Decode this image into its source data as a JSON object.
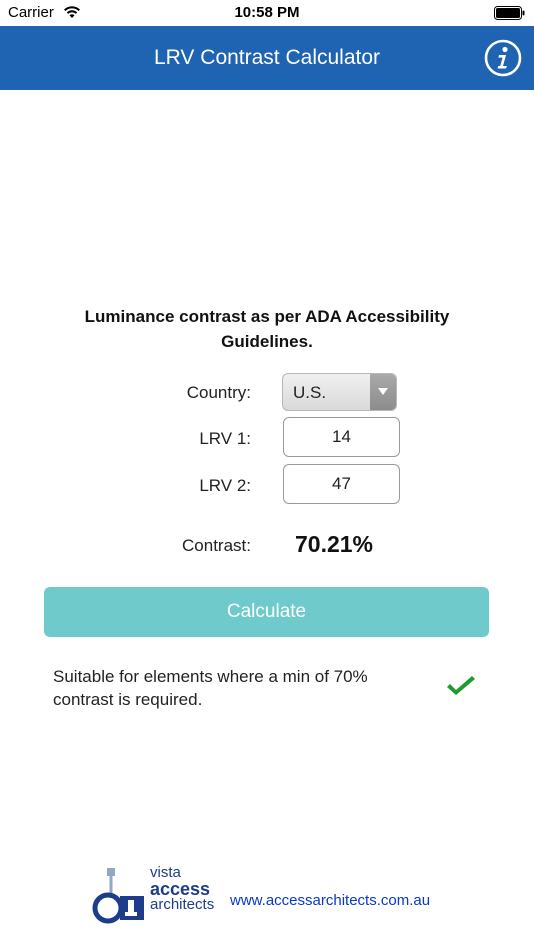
{
  "status_bar": {
    "carrier": "Carrier",
    "time": "10:58 PM"
  },
  "nav": {
    "title": "LRV Contrast Calculator",
    "info_icon": "info-icon"
  },
  "main": {
    "headline": "Luminance contrast as per ADA Accessibility Guidelines.",
    "country_label": "Country:",
    "country_value": "U.S.",
    "lrv1_label": "LRV 1:",
    "lrv1_value": "14",
    "lrv2_label": "LRV 2:",
    "lrv2_value": "47",
    "contrast_label": "Contrast:",
    "contrast_value": "70.21%",
    "calculate_label": "Calculate",
    "result_text": "Suitable for elements where a min of 70% contrast is required.",
    "result_icon": "checkmark-icon"
  },
  "footer": {
    "logo_line1": "vista",
    "logo_line2": "access",
    "logo_line3": "architects",
    "website": "www.accessarchitects.com.au"
  },
  "colors": {
    "nav_background": "#1f63b3",
    "button_background": "#6fcbcb",
    "checkmark": "#1e9c2a",
    "link": "#0b38c9"
  }
}
